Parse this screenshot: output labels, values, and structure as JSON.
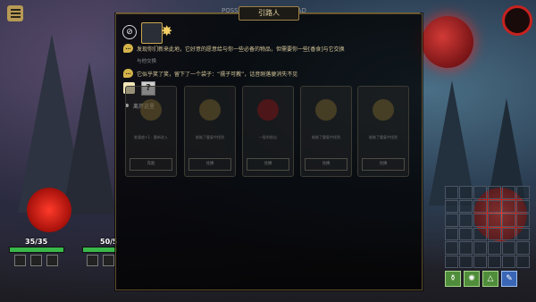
{
  "dialog": {
    "title": "引路人",
    "line1": "发现你们新来此地，它好意的愿意给与你一些必备的物品，但需要你一些[香食]与它交换",
    "option1": "与他交换",
    "line2": "它似乎笑了笑，留下了一个袋子：“孺子可教”，话音刚落便消失不见",
    "leave_label": "离开这里",
    "icons": [
      "no-entry-icon",
      "character-portrait-icon",
      "sun-icon",
      "speech-icon",
      "gift-icon",
      "question-icon"
    ],
    "cards": [
      {
        "label": "能量度+1 · 重新进入",
        "button": "充能"
      },
      {
        "label": "能能了重复中找到",
        "button": "兑换"
      },
      {
        "label": "一股利前出",
        "button": "兑换"
      },
      {
        "label": "能能了重复中找到",
        "button": "兑换"
      },
      {
        "label": "能能了重复中找到",
        "button": "兑换"
      }
    ]
  },
  "background_title": "POSSESSION OF THE DEAD",
  "party": [
    {
      "hp": "35/35",
      "hp_ratio": 1.0
    },
    {
      "hp": "50/5",
      "hp_ratio": 1.0
    }
  ],
  "toolbar": {
    "buttons": [
      "potion-icon",
      "gear-icon",
      "triangle-icon",
      "wrench-icon"
    ],
    "glyphs": [
      "⚱",
      "✺",
      "△",
      "✎"
    ]
  },
  "colors": {
    "accent": "#c9a64f",
    "hp": "#39b84a",
    "moon": "#d23a36"
  }
}
